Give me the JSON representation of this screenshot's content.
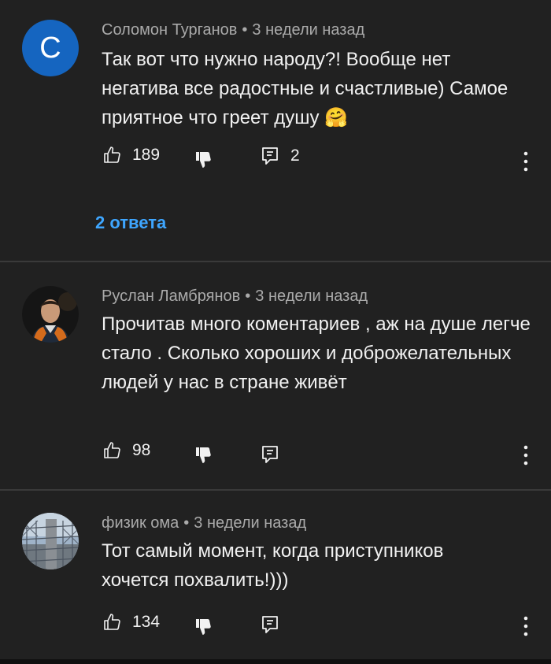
{
  "comments": [
    {
      "avatar": {
        "type": "letter",
        "letter": "С",
        "color": "#1565c0"
      },
      "author": "Соломон Турганов",
      "time": "3 недели назад",
      "text": "Так вот что нужно народу?! Вообще нет негатива все радостные и счастливые) Самое приятное что греет душу",
      "emoji": "🤗",
      "likes": "189",
      "reply_count": "2",
      "replies_link": "2 ответа"
    },
    {
      "avatar": {
        "type": "photo",
        "description_icon": "person-avatar"
      },
      "author": "Руслан Ламбрянов",
      "time": "3 недели назад",
      "text": "Прочитав много коментариев , аж на душе легче стало . Сколько хороших и доброжелательных людей у нас в стране живёт",
      "likes": "98"
    },
    {
      "avatar": {
        "type": "photo",
        "description_icon": "fence-avatar"
      },
      "author": "физик ома",
      "time": "3 недели назад",
      "text": "Тот самый момент, когда приступников хочется похвалить!)))",
      "likes": "134"
    }
  ],
  "meta_separator": "•",
  "colors": {
    "background": "#212121",
    "link": "#3ea6ff",
    "meta": "#aaaaaa"
  }
}
